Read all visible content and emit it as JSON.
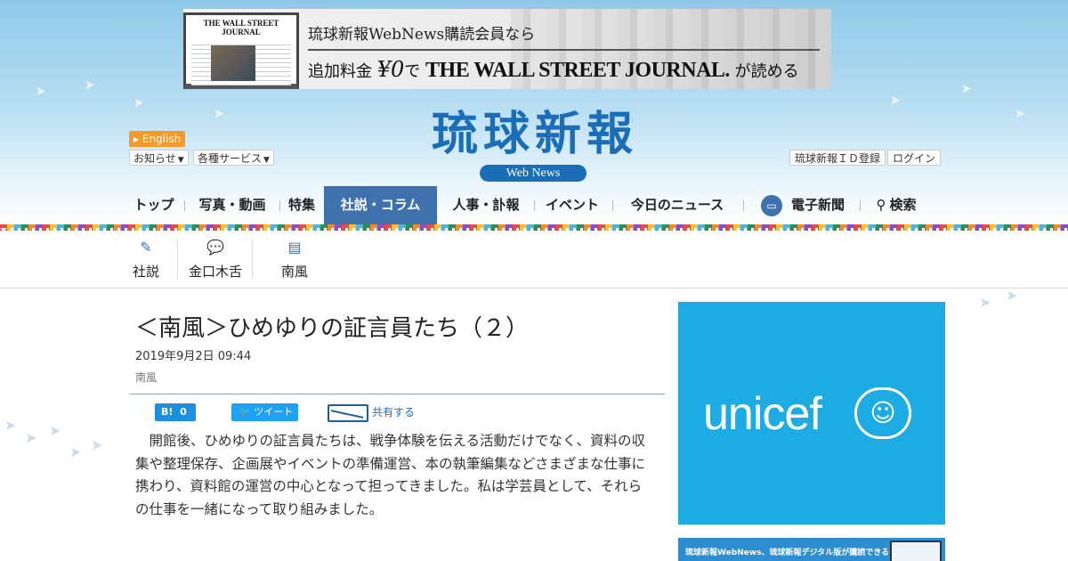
{
  "ad_banner": {
    "line1": "琉球新報WebNews購読会員なら",
    "line2_prefix": "追加料金",
    "line2_price": "¥0",
    "line2_de": "で",
    "line2_brand": "THE WALL STREET JOURNAL.",
    "line2_suffix": "が読める",
    "laptop_masthead": "THE WALL STREET JOURNAL"
  },
  "header": {
    "english_label": "English",
    "notice_label": "お知らせ",
    "services_label": "各種サービス",
    "logo": "琉球新報",
    "logo_sub": "Web News",
    "register_label": "琉球新報ＩＤ登録",
    "login_label": "ログイン"
  },
  "nav": {
    "items": [
      "トップ",
      "写真・動画",
      "特集",
      "社説・コラム",
      "人事・訃報",
      "イベント",
      "今日のニュース"
    ],
    "epaper": "電子新聞",
    "search": "検索",
    "active": "社説・コラム"
  },
  "subnav": {
    "items": [
      {
        "label": "社説",
        "icon": "pen-icon"
      },
      {
        "label": "金口木舌",
        "icon": "speech-bubble-icon"
      },
      {
        "label": "南風",
        "icon": "chat-icon"
      }
    ]
  },
  "article": {
    "title": "＜南風＞ひめゆりの証言員たち（２）",
    "date": "2019年9月2日 09:44",
    "category": "南風",
    "hatena_label": "B!",
    "hatena_count": "0",
    "tweet_label": "ツイート",
    "share_label": "共有する",
    "body": "開館後、ひめゆりの証言員たちは、戦争体験を伝える活動だけでなく、資料の収集や整理保存、企画展やイベントの準備運営、本の執筆編集などさまざまな仕事に携わり、資料館の運営の中心となって担ってきました。私は学芸員として、それらの仕事を一緒になって取り組みました。"
  },
  "sidebar": {
    "ad1_text": "unicef",
    "ad2_text": "琉球新報WebNews、琉球新報デジタル版が購読できる"
  },
  "colors": {
    "brand_blue": "#1a6eb8",
    "nav_active": "#3f71ad",
    "english_orange": "#f39a2b",
    "unicef_blue": "#1cabe2"
  }
}
